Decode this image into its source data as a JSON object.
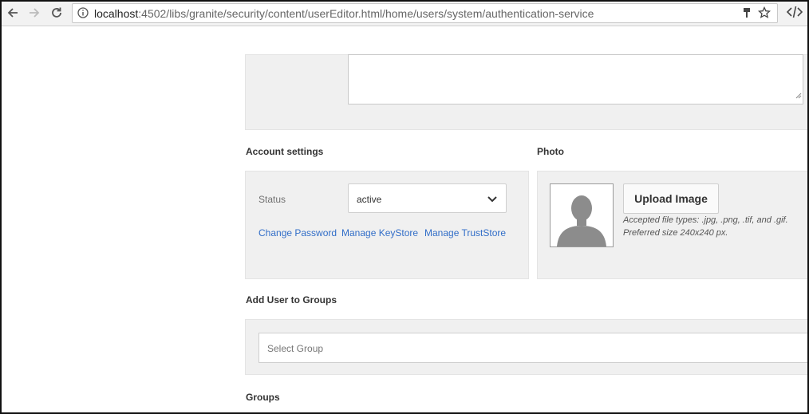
{
  "browser": {
    "url_host": "localhost",
    "url_path": ":4502/libs/granite/security/content/userEditor.html/home/users/system/authentication-service",
    "icons": [
      "back-arrow-icon",
      "forward-arrow-icon",
      "reload-icon",
      "info-icon",
      "key-icon",
      "star-icon",
      "devtools-icon"
    ]
  },
  "account_settings": {
    "title": "Account settings",
    "status_label": "Status",
    "status_value": "active",
    "links": [
      "Change Password",
      "Manage KeyStore",
      "Manage TrustStore"
    ]
  },
  "photo": {
    "title": "Photo",
    "upload_label": "Upload Image",
    "hint_line1": "Accepted file types: .jpg, .png, .tif, and .gif.",
    "hint_line2": "Preferred size 240x240 px."
  },
  "add_groups": {
    "title": "Add User to Groups",
    "placeholder": "Select Group"
  },
  "groups": {
    "title": "Groups"
  },
  "colors": {
    "link": "#326ec8",
    "panel": "#f0f0f0"
  }
}
